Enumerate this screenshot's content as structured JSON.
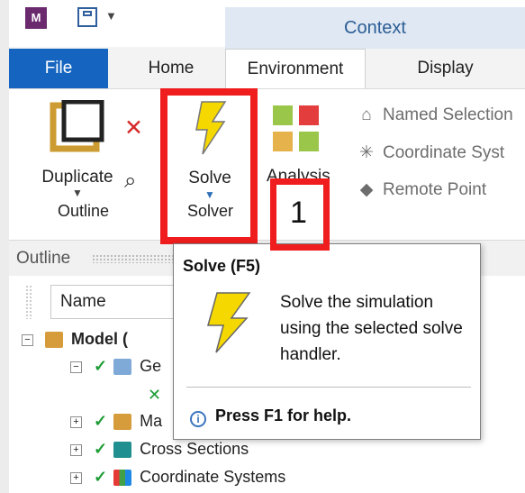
{
  "window": {
    "app_logo": "M",
    "context_tab": "Context"
  },
  "ribbon_tabs": [
    "File",
    "Home",
    "Environment",
    "Display"
  ],
  "ribbon": {
    "duplicate": "Duplicate",
    "solve": "Solve",
    "analysis": "Analysis",
    "group_outline": "Outline",
    "group_solver": "Solver",
    "named_selection": "Named Selection",
    "coordinate_system": "Coordinate Syst",
    "remote_point": "Remote Point"
  },
  "outline": {
    "title": "Outline",
    "filter_value": "Name"
  },
  "tree": {
    "items": [
      {
        "label": "Model (",
        "bold": true
      },
      {
        "label": "Ge",
        "bold": false
      },
      {
        "label": "Ma",
        "bold": false
      },
      {
        "label": "Cross Sections",
        "bold": false
      },
      {
        "label": "Coordinate Systems",
        "bold": false
      }
    ]
  },
  "tooltip": {
    "title": "Solve (F5)",
    "description": "Solve the simulation using the selected solve handler.",
    "help": "Press F1 for help."
  },
  "annotation": {
    "step": "1",
    "highlight_color": "#ef1d1d"
  },
  "colors": {
    "file_tab": "#1565c0",
    "context_bg": "#dfe8f3",
    "context_text": "#2c5d95"
  }
}
